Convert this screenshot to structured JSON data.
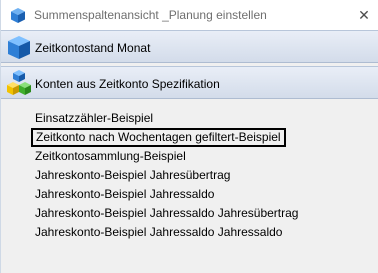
{
  "window": {
    "title": "Summenspaltenansicht _Planung einstellen",
    "close_glyph": "✕",
    "title_icon": "blue-cube-icon"
  },
  "panels": [
    {
      "label": "Zeitkontostand Monat",
      "icon": "blue-cube-icon"
    },
    {
      "label": "Konten aus Zeitkonto Spezifikation",
      "icon": "colored-cubes-icon"
    }
  ],
  "list": {
    "items": [
      {
        "label": "Einsatzzähler-Beispiel",
        "selected": false
      },
      {
        "label": "Zeitkonto nach Wochentagen gefiltert-Beispiel",
        "selected": true
      },
      {
        "label": "Zeitkontosammlung-Beispiel",
        "selected": false
      },
      {
        "label": "Jahreskonto-Beispiel Jahresübertrag",
        "selected": false
      },
      {
        "label": "Jahreskonto-Beispiel Jahressaldo",
        "selected": false
      },
      {
        "label": "Jahreskonto-Beispiel Jahressaldo Jahresübertrag",
        "selected": false
      },
      {
        "label": "Jahreskonto-Beispiel Jahressaldo Jahressaldo",
        "selected": false
      }
    ]
  },
  "colors": {
    "panel_gradient_top": "#e9eef7",
    "panel_gradient_bottom": "#d3dcea",
    "cube_blue": "#2f7fd6",
    "selection_border": "#000000"
  }
}
